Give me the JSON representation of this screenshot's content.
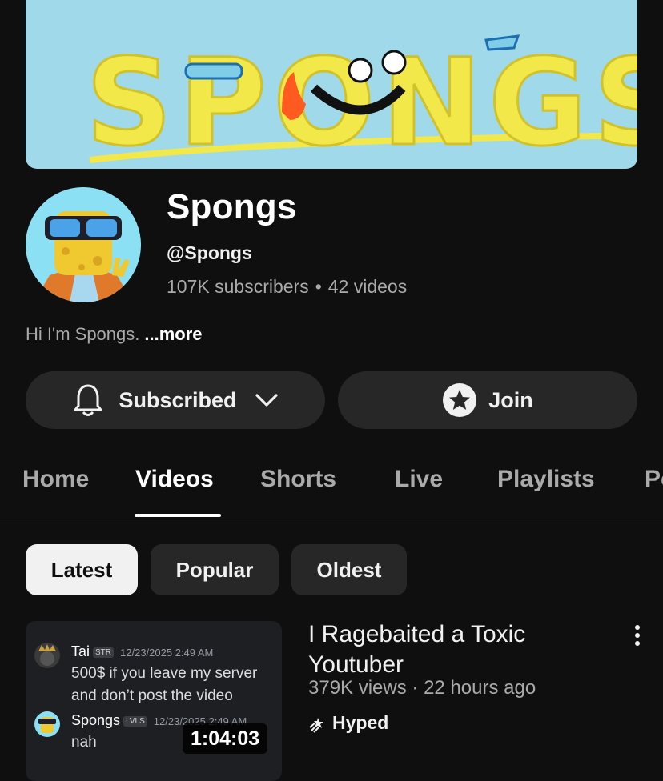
{
  "channel": {
    "banner_text": "SPONGS",
    "name": "Spongs",
    "handle": "@Spongs",
    "subscribers": "107K subscribers",
    "videos_count": "42 videos",
    "stats_separator": "•",
    "description": "Hi I'm Spongs.",
    "more_label": "...more"
  },
  "actions": {
    "subscribe_label": "Subscribed",
    "join_label": "Join"
  },
  "tabs": [
    {
      "label": "Home"
    },
    {
      "label": "Videos",
      "active": true
    },
    {
      "label": "Shorts"
    },
    {
      "label": "Live"
    },
    {
      "label": "Playlists"
    },
    {
      "label": "Po"
    }
  ],
  "chips": [
    {
      "label": "Latest",
      "active": true
    },
    {
      "label": "Popular"
    },
    {
      "label": "Oldest"
    }
  ],
  "video": {
    "title": "I Ragebaited a Toxic Youtuber",
    "views": "379K views",
    "separator": "·",
    "age": "22 hours ago",
    "badge": "Hyped",
    "duration": "1:04:03",
    "thumbnail": {
      "msg1_name": "Tai",
      "msg1_tag": "STR",
      "msg1_time": "12/23/2025 2:49 AM",
      "msg1_line1": "500$ if you leave my server",
      "msg1_line2": "and don’t  post the video",
      "msg2_name": "Spongs",
      "msg2_tag": "LVLS",
      "msg2_time": "12/23/2025 2:49 AM",
      "msg2_text": "nah"
    }
  },
  "colors": {
    "background": "#0f0f0f",
    "surface": "#272727",
    "text_primary": "#f1f1f1",
    "text_secondary": "#aaaaaa",
    "banner_bg": "#9fd9ea"
  }
}
